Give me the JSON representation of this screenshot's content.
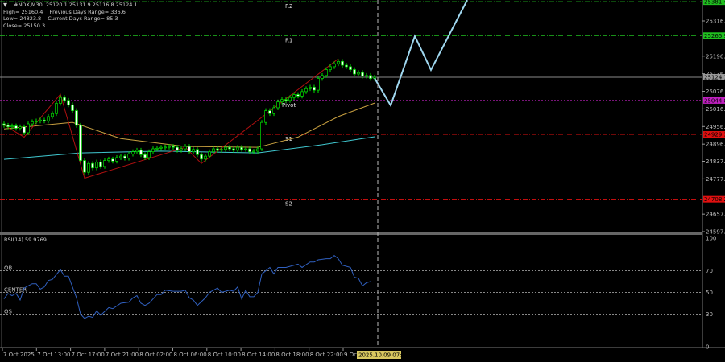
{
  "header": {
    "symbol_line": "#NDX,M30  25120.1 25131.9 25116.8 25124.1",
    "high": "High= 25160.4",
    "prev_range": "Previous Days Range= 336.6",
    "low": "Low= 24823.8",
    "cur_range": "Current Days Range= 85.3",
    "close": "Close= 25150.3"
  },
  "colors": {
    "background": "#000000",
    "candle": "#00e000",
    "ma_slow": "#c8a040",
    "ma_fast": "#40c8d0",
    "zigzag": "#b01010",
    "projection": "#a0d8f0",
    "rsi": "#3060c0",
    "resistance": "#20c020",
    "pivot": "#c020c0",
    "support": "#e01010"
  },
  "chart_data": [
    {
      "type": "candlestick",
      "symbol": "#NDX",
      "timeframe": "M30",
      "ylim": [
        24597.5,
        25381.4
      ],
      "y_ticks": [
        "25316.0",
        "25196.0",
        "25136.0",
        "25076.0",
        "25016.0",
        "24956.0",
        "24896.0",
        "24837.5",
        "24777.5",
        "24657.5",
        "24597.5"
      ],
      "x_ticks": [
        "7 Oct 2025",
        "7 Oct 13:00",
        "7 Oct 17:00",
        "7 Oct 21:00",
        "8 Oct 02:00",
        "8 Oct 06:00",
        "8 Oct 10:00",
        "8 Oct 14:00",
        "8 Oct 18:00",
        "8 Oct 22:00",
        "9 Oct"
      ],
      "cursor_time": "2025.10.09 07:00",
      "close": [
        24960,
        24955,
        24958,
        24950,
        24955,
        24935,
        24965,
        24972,
        24975,
        24978,
        24975,
        24990,
        25000,
        25035,
        25055,
        25045,
        25030,
        25010,
        24960,
        24840,
        24800,
        24830,
        24815,
        24835,
        24820,
        24840,
        24845,
        24838,
        24850,
        24855,
        24848,
        24862,
        24870,
        24875,
        24860,
        24850,
        24870,
        24880,
        24882,
        24885,
        24886,
        24888,
        24885,
        24875,
        24880,
        24888,
        24870,
        24878,
        24860,
        24845,
        24855,
        24870,
        24880,
        24875,
        24878,
        24885,
        24880,
        24875,
        24885,
        24878,
        24880,
        24870,
        24872,
        24880,
        24970,
        25010,
        25000,
        25020,
        25040,
        25048,
        25045,
        25055,
        25065,
        25060,
        25075,
        25085,
        25090,
        25080,
        25120,
        25130,
        25150,
        25160,
        25170,
        25178,
        25165,
        25160,
        25150,
        25135,
        25140,
        25128,
        25130,
        25120,
        25124
      ],
      "current_price": "25124.1",
      "levels": [
        {
          "name": "R2",
          "value": "25381.4",
          "kind": "resistance"
        },
        {
          "name": "R1",
          "value": "25265.9",
          "kind": "resistance"
        },
        {
          "name": "Pivot",
          "value": "25044.8",
          "kind": "pivot"
        },
        {
          "name": "S1",
          "value": "24929.3",
          "kind": "support"
        },
        {
          "name": "S2",
          "value": "24708.2",
          "kind": "support"
        }
      ],
      "ma_slow": {
        "bars": [
          0,
          17,
          29,
          45,
          63,
          73,
          83,
          92
        ],
        "values": [
          24948,
          24970,
          24915,
          24888,
          24885,
          24920,
          24990,
          25036
        ]
      },
      "ma_fast": {
        "bars": [
          0,
          19,
          39,
          63,
          79,
          92
        ],
        "values": [
          24844,
          24866,
          24872,
          24866,
          24894,
          24921
        ]
      },
      "zigzag": {
        "bars": [
          0,
          5,
          14,
          20,
          45,
          49,
          83
        ],
        "values": [
          24961,
          24920,
          25066,
          24780,
          24885,
          24830,
          25187
        ]
      },
      "projection": {
        "bars": [
          92,
          96,
          102,
          106,
          115
        ],
        "values": [
          25121,
          25028,
          25264,
          25149,
          25387
        ]
      }
    },
    {
      "type": "line",
      "title": "RSI(14) 59.9769",
      "ylim": [
        0,
        100
      ],
      "y_ticks": [
        "100",
        "70",
        "50",
        "30",
        "0"
      ],
      "level_labels": [
        "OB",
        "CENTER",
        "OS"
      ],
      "level_values": [
        70,
        50,
        30
      ],
      "points": [
        [
          0,
          44
        ],
        [
          1,
          49
        ],
        [
          2,
          47
        ],
        [
          3,
          49
        ],
        [
          4,
          43
        ],
        [
          5,
          54
        ],
        [
          7,
          58
        ],
        [
          8,
          58
        ],
        [
          9,
          53
        ],
        [
          10,
          55
        ],
        [
          11,
          61
        ],
        [
          12,
          62
        ],
        [
          14,
          71
        ],
        [
          15,
          65
        ],
        [
          16,
          65
        ],
        [
          17,
          55
        ],
        [
          18,
          45
        ],
        [
          19,
          30
        ],
        [
          20,
          26
        ],
        [
          21,
          28
        ],
        [
          22,
          27
        ],
        [
          23,
          33
        ],
        [
          24,
          29
        ],
        [
          26,
          36
        ],
        [
          27,
          35
        ],
        [
          29,
          40
        ],
        [
          31,
          41
        ],
        [
          32,
          45
        ],
        [
          33,
          47
        ],
        [
          34,
          40
        ],
        [
          35,
          38
        ],
        [
          36,
          40
        ],
        [
          38,
          48
        ],
        [
          39,
          48
        ],
        [
          40,
          52
        ],
        [
          42,
          51
        ],
        [
          44,
          51
        ],
        [
          45,
          52
        ],
        [
          46,
          45
        ],
        [
          47,
          43
        ],
        [
          48,
          38
        ],
        [
          50,
          45
        ],
        [
          51,
          50
        ],
        [
          53,
          54
        ],
        [
          54,
          50
        ],
        [
          56,
          52
        ],
        [
          57,
          51
        ],
        [
          58,
          55
        ],
        [
          59,
          44
        ],
        [
          60,
          52
        ],
        [
          61,
          46
        ],
        [
          62,
          46
        ],
        [
          63,
          50
        ],
        [
          64,
          67
        ],
        [
          66,
          73
        ],
        [
          67,
          67
        ],
        [
          68,
          73
        ],
        [
          69,
          73
        ],
        [
          70,
          73
        ],
        [
          72,
          75
        ],
        [
          73,
          76
        ],
        [
          74,
          73
        ],
        [
          76,
          78
        ],
        [
          77,
          78
        ],
        [
          78,
          80
        ],
        [
          80,
          81
        ],
        [
          81,
          81
        ],
        [
          82,
          84
        ],
        [
          83,
          81
        ],
        [
          84,
          75
        ],
        [
          86,
          73
        ],
        [
          87,
          64
        ],
        [
          88,
          63
        ],
        [
          89,
          56
        ],
        [
          90,
          59
        ],
        [
          91,
          60
        ]
      ]
    }
  ]
}
